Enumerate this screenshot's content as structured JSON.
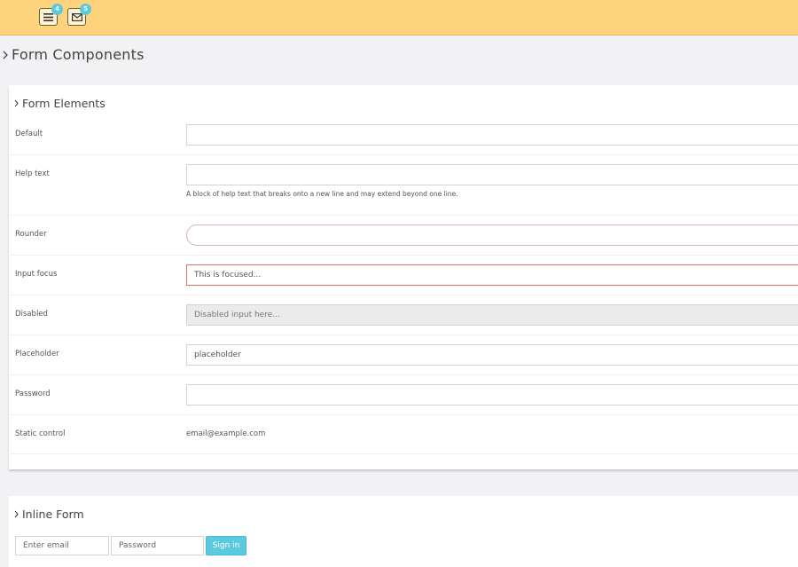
{
  "topbar": {
    "menu_badge": "4",
    "mail_badge": "5"
  },
  "page": {
    "title": "Form Components"
  },
  "form_elements": {
    "title": "Form Elements",
    "rows": {
      "default": {
        "label": "Default",
        "value": ""
      },
      "help_text": {
        "label": "Help text",
        "value": "",
        "help": "A block of help text that breaks onto a new line and may extend beyond one line."
      },
      "rounder": {
        "label": "Rounder",
        "value": ""
      },
      "input_focus": {
        "label": "Input focus",
        "value": "This is focused..."
      },
      "disabled": {
        "label": "Disabled",
        "placeholder": "Disabled input here..."
      },
      "placeholder": {
        "label": "Placeholder",
        "placeholder": "placeholder"
      },
      "password": {
        "label": "Password",
        "value": ""
      },
      "static_control": {
        "label": "Static control",
        "value": "email@example.com"
      }
    }
  },
  "inline_form": {
    "title": "Inline Form",
    "email_placeholder": "Enter email",
    "password_placeholder": "Password",
    "submit_label": "Sign in"
  },
  "colors": {
    "topbar": "#fed37c",
    "badge": "#5bc9de",
    "focus_border": "#e46a6a",
    "button": "#5bc9de"
  }
}
